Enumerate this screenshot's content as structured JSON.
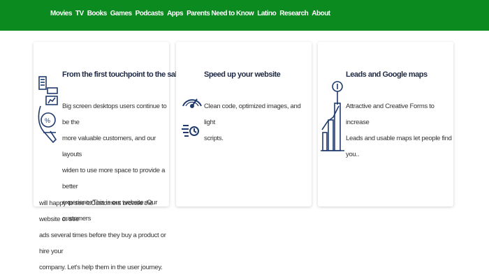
{
  "nav": {
    "items": [
      "Movies",
      "TV",
      "Books",
      "Games",
      "Podcasts",
      "Apps",
      "Parents Need to Know",
      "Latino",
      "Research",
      "About"
    ]
  },
  "cards": [
    {
      "title": "From the first touchpoint to the sale",
      "lines": [
        "Big screen desktops users continue to be the",
        "more valuable customers, and our layouts",
        "widen to use more space to provide a better",
        "experienceThis is our website. Our customers"
      ],
      "overflow_lines": [
        "will happy to see it.Customers browse the website or see",
        "ads several times before they buy a product or hire your",
        "company. Let's help them in the user journey."
      ],
      "icon": "analytics-person-icon"
    },
    {
      "title": "Speed up your website",
      "lines": [
        "Clean code, optimized images, and light",
        "scripts."
      ],
      "icon": "speedometer-icon"
    },
    {
      "title": "Leads and Google maps",
      "lines": [
        "Attractive and Creative Forms to increase",
        "Leads and usable maps let people find you.."
      ],
      "icon": "growth-chart-icon"
    }
  ],
  "colors": {
    "nav_bg": "#0a8a1f",
    "icon": "#1f3a6e",
    "text": "#333333"
  }
}
